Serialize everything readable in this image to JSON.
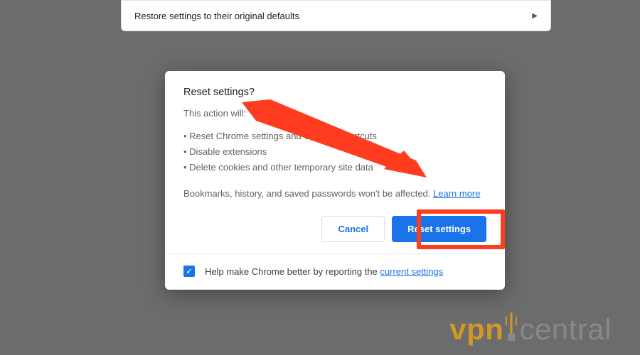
{
  "restore_bar": {
    "label": "Restore settings to their original defaults"
  },
  "dialog": {
    "title": "Reset settings?",
    "subhead": "This action will:",
    "bullets": [
      "Reset Chrome settings and Chrome shortcuts",
      "Disable extensions",
      "Delete cookies and other temporary site data"
    ],
    "note_pre": "Bookmarks, history, and saved passwords won't be affected. ",
    "learn_more": "Learn more",
    "cancel_label": "Cancel",
    "primary_label": "Reset settings",
    "footer_pre": "Help make Chrome better by reporting the ",
    "footer_link": "current settings",
    "footer_checked": true
  },
  "annotations": {
    "arrow_target": "reset-settings-button"
  },
  "watermark": {
    "brand_left": "vpn",
    "brand_right": "central"
  }
}
